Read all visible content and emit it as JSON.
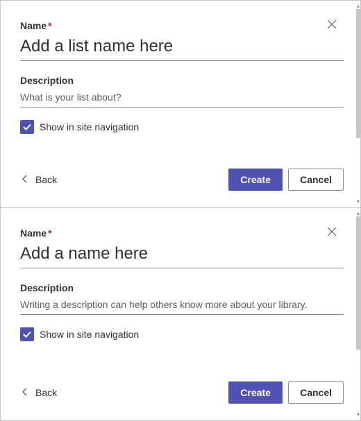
{
  "dialog1": {
    "nameLabel": "Name",
    "required": "*",
    "namePlaceholder": "Add a list name here",
    "nameValue": "",
    "descLabel": "Description",
    "descPlaceholder": "What is your list about?",
    "descValue": "",
    "checkboxLabel": "Show in site navigation",
    "checkboxChecked": true,
    "backLabel": "Back",
    "createLabel": "Create",
    "cancelLabel": "Cancel"
  },
  "dialog2": {
    "nameLabel": "Name",
    "required": "*",
    "namePlaceholder": "Add a name here",
    "nameValue": "",
    "descLabel": "Description",
    "descPlaceholder": "Writing a description can help others know more about your library.",
    "descValue": "",
    "checkboxLabel": "Show in site navigation",
    "checkboxChecked": true,
    "backLabel": "Back",
    "createLabel": "Create",
    "cancelLabel": "Cancel"
  }
}
